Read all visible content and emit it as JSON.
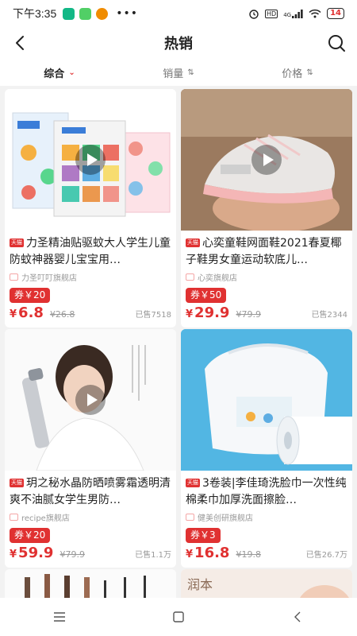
{
  "status_bar": {
    "time": "下午3:35",
    "dots": "•••",
    "net_label": "HD",
    "signal_label": "4G",
    "battery": "14"
  },
  "header": {
    "title": "热销",
    "back_icon": "back-arrow-icon",
    "search_icon": "search-icon"
  },
  "sort_bar": {
    "items": [
      {
        "label": "综合",
        "arrow": "⌄",
        "active": true
      },
      {
        "label": "销量",
        "arrow": "⇅",
        "active": false
      },
      {
        "label": "价格",
        "arrow": "⇅",
        "active": false
      }
    ]
  },
  "products": [
    {
      "tag": "天猫",
      "title": "力圣精油贴驱蚊大人学生儿童防蚊神器婴儿宝宝用…",
      "shop": "力圣叮叮旗舰店",
      "coupon": "券￥20",
      "price_symbol": "¥",
      "price": "6.8",
      "original_price": "¥26.8",
      "sold": "已售7518"
    },
    {
      "tag": "天猫",
      "title": "心奕童鞋网面鞋2021春夏椰子鞋男女童运动软底儿…",
      "shop": "心奕旗舰店",
      "coupon": "券￥50",
      "price_symbol": "¥",
      "price": "29.9",
      "original_price": "¥79.9",
      "sold": "已售2344"
    },
    {
      "tag": "天猫",
      "title": "玥之秘水晶防晒喷雾霜透明清爽不油腻女学生男防…",
      "shop": "recipe旗舰店",
      "coupon": "券￥20",
      "price_symbol": "¥",
      "price": "59.9",
      "original_price": "¥79.9",
      "sold": "已售1.1万"
    },
    {
      "tag": "天猫",
      "title": "3卷装|李佳琦洗脸巾一次性纯棉柔巾加厚洗面擦脸…",
      "shop": "健美创研旗舰店",
      "coupon": "券￥3",
      "price_symbol": "¥",
      "price": "16.8",
      "original_price": "¥19.8",
      "sold": "已售26.7万"
    }
  ],
  "partial_card_text": "润本",
  "nav_bar": {
    "icons": [
      "menu-icon",
      "home-square-icon",
      "back-triangle-icon"
    ]
  },
  "colors": {
    "accent": "#e03131",
    "background": "#f2f2f2"
  }
}
